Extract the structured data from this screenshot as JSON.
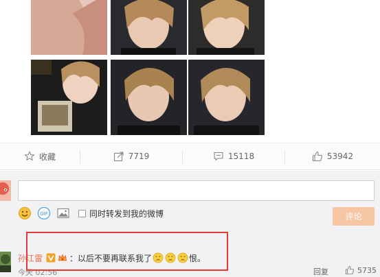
{
  "photos": [
    {
      "alt": "photo-1",
      "bg": "#d9b8a8"
    },
    {
      "alt": "photo-2",
      "bg": "#2b2b2b"
    },
    {
      "alt": "photo-3",
      "bg": "#2a2a2a"
    },
    {
      "alt": "photo-4",
      "bg": "#1e1e1e"
    },
    {
      "alt": "photo-5",
      "bg": "#1f1f24"
    },
    {
      "alt": "photo-6",
      "bg": "#24242a"
    }
  ],
  "actions": {
    "favorite": "收藏",
    "repost": "7719",
    "comments": "15118",
    "likes": "53942"
  },
  "compose": {
    "placeholder": "",
    "share_checkbox_label": "同时转发到我的微博",
    "submit_label": "评论"
  },
  "comment": {
    "username": "孙江雷",
    "text_before": "：以后不要再联系我了",
    "text_after": "恨。",
    "time": "今天 02:56",
    "reply_label": "回复",
    "like_count": "5735"
  },
  "colors": {
    "accent": "#eb7350",
    "submit_disabled": "#f7c6a5",
    "highlight": "#e53935"
  }
}
